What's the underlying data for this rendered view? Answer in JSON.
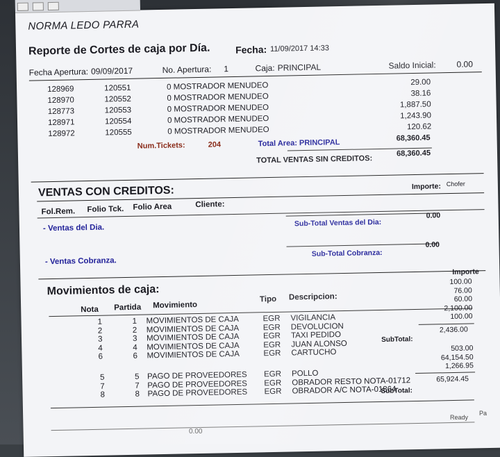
{
  "report": {
    "company": "NORMA LEDO PARRA",
    "title": "Reporte de Cortes de caja por Día.",
    "date_label": "Fecha:",
    "date_value": "11/09/2017 14:33",
    "fecha_apertura_label": "Fecha Apertura:",
    "fecha_apertura_value": "09/09/2017",
    "no_apertura_label": "No. Apertura:",
    "no_apertura_value": "1",
    "caja_label": "Caja:",
    "caja_value": "PRINCIPAL",
    "saldo_inicial_label": "Saldo Inicial:",
    "saldo_inicial_value": "0.00"
  },
  "tickets": [
    {
      "id": "128969",
      "folio": "120551",
      "desc": "0 MOSTRADOR MENUDEO",
      "amount": "29.00"
    },
    {
      "id": "128970",
      "folio": "120552",
      "desc": "0 MOSTRADOR MENUDEO",
      "amount": "38.16"
    },
    {
      "id": "128773",
      "folio": "120553",
      "desc": "0 MOSTRADOR MENUDEO",
      "amount": "1,887.50"
    },
    {
      "id": "128971",
      "folio": "120554",
      "desc": "0 MOSTRADOR MENUDEO",
      "amount": "1,243.90"
    },
    {
      "id": "128972",
      "folio": "120555",
      "desc": "0 MOSTRADOR MENUDEO",
      "amount": "120.62"
    }
  ],
  "totals": {
    "num_tickets_label": "Num.Tickets:",
    "num_tickets_value": "204",
    "total_area_label": "Total Area: PRINCIPAL",
    "total_area_value": "68,360.45",
    "total_ventas_label": "TOTAL VENTAS SIN CREDITOS:",
    "total_ventas_value": "68,360.45"
  },
  "creditos": {
    "title": "VENTAS CON CREDITOS:",
    "importe_label": "Importe:",
    "chofer_label": "Chofer",
    "col_folrem": "Fol.Rem.",
    "col_foliotck": "Folio Tck.",
    "col_folioarea": "Folio Area",
    "col_cliente": "Cliente:",
    "ventas_dia": "- Ventas del Dia.",
    "subtotal_ventas_label": "Sub-Total Ventas del Dia:",
    "subtotal_ventas_value": "0.00",
    "ventas_cobranza": "- Ventas Cobranza.",
    "subtotal_cobranza_label": "Sub-Total Cobranza:",
    "subtotal_cobranza_value": "0.00"
  },
  "movimientos": {
    "title": "Movimientos de caja:",
    "importe_header": "Importe",
    "col_nota": "Nota",
    "col_partida": "Partida",
    "col_movimiento": "Movimiento",
    "col_tipo": "Tipo",
    "col_descripcion": "Descripcion:",
    "rows": [
      {
        "nota": "1",
        "partida": "1",
        "mov": "MOVIMIENTOS DE CAJA",
        "tipo": "EGR",
        "desc": "VIGILANCIA"
      },
      {
        "nota": "2",
        "partida": "2",
        "mov": "MOVIMIENTOS DE CAJA",
        "tipo": "EGR",
        "desc": "DEVOLUCION"
      },
      {
        "nota": "3",
        "partida": "3",
        "mov": "MOVIMIENTOS DE CAJA",
        "tipo": "EGR",
        "desc": "TAXI PEDIDO"
      },
      {
        "nota": "4",
        "partida": "4",
        "mov": "MOVIMIENTOS DE CAJA",
        "tipo": "EGR",
        "desc": "JUAN ALONSO"
      },
      {
        "nota": "6",
        "partida": "6",
        "mov": "MOVIMIENTOS DE CAJA",
        "tipo": "EGR",
        "desc": "CARTUCHO"
      }
    ],
    "amounts_group1": [
      "100.00",
      "76.00",
      "60.00",
      "2,100.00",
      "100.00"
    ],
    "subtotal1_label": "SubTotal:",
    "subtotal1_value": "2,436.00",
    "rows2": [
      {
        "nota": "5",
        "partida": "5",
        "mov": "PAGO DE PROVEEDORES",
        "tipo": "EGR",
        "desc": "POLLO"
      },
      {
        "nota": "7",
        "partida": "7",
        "mov": "PAGO DE PROVEEDORES",
        "tipo": "EGR",
        "desc": "OBRADOR RESTO NOTA-01712"
      },
      {
        "nota": "8",
        "partida": "8",
        "mov": "PAGO DE PROVEEDORES",
        "tipo": "EGR",
        "desc": "OBRADOR A/C NOTA-01864"
      }
    ],
    "amounts_group2": [
      "503.00",
      "64,154.50",
      "1,266.95"
    ],
    "subtotal2_label": "SubTotal:",
    "subtotal2_value": "65,924.45"
  },
  "footer": {
    "status": "Ready",
    "status2": "Pa",
    "bottom_value": "0.00"
  }
}
